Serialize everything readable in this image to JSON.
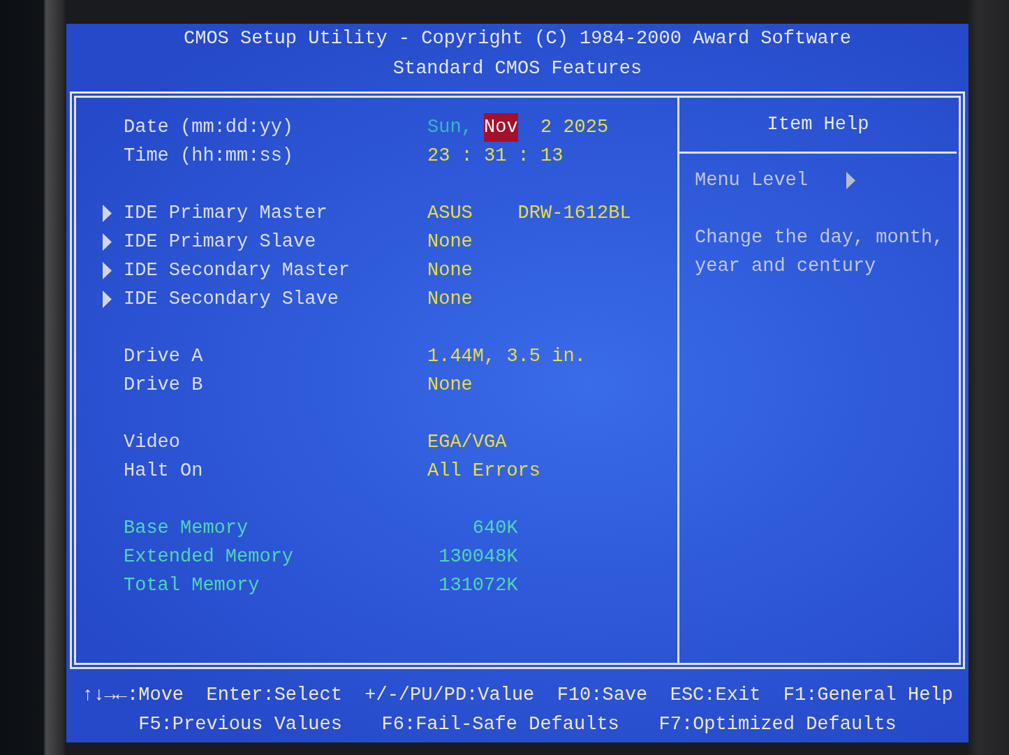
{
  "header": {
    "title": "CMOS Setup Utility - Copyright (C) 1984-2000 Award Software",
    "subtitle": "Standard CMOS Features"
  },
  "setting_groups": [
    {
      "rows": [
        {
          "kind": "date",
          "label": "Date (mm:dd:yy)",
          "weekday": "Sun,",
          "fields": [
            {
              "text": "Nov",
              "selected": true
            },
            {
              "text": "2",
              "selected": false
            },
            {
              "text": "2025",
              "selected": false
            }
          ]
        },
        {
          "kind": "time",
          "label": "Time (hh:mm:ss)",
          "separator": ":",
          "fields": [
            {
              "text": "23",
              "selected": false
            },
            {
              "text": "31",
              "selected": false
            },
            {
              "text": "13",
              "selected": false
            }
          ]
        }
      ]
    },
    {
      "rows": [
        {
          "kind": "submenu",
          "label": "IDE Primary Master",
          "value": "ASUS    DRW-1612BL"
        },
        {
          "kind": "submenu",
          "label": "IDE Primary Slave",
          "value": "None"
        },
        {
          "kind": "submenu",
          "label": "IDE Secondary Master",
          "value": "None"
        },
        {
          "kind": "submenu",
          "label": "IDE Secondary Slave",
          "value": "None"
        }
      ]
    },
    {
      "rows": [
        {
          "kind": "option",
          "label": "Drive A",
          "value": "1.44M, 3.5 in."
        },
        {
          "kind": "option",
          "label": "Drive B",
          "value": "None"
        }
      ]
    },
    {
      "rows": [
        {
          "kind": "option",
          "label": "Video",
          "value": "EGA/VGA"
        },
        {
          "kind": "option",
          "label": "Halt On",
          "value": "All Errors"
        }
      ]
    },
    {
      "rows": [
        {
          "kind": "info",
          "label": "Base Memory",
          "value": "640K"
        },
        {
          "kind": "info",
          "label": "Extended Memory",
          "value": "130048K"
        },
        {
          "kind": "info",
          "label": "Total Memory",
          "value": "131072K"
        }
      ]
    }
  ],
  "item_help": {
    "title": "Item Help",
    "menu_level": "Menu Level",
    "text": "Change the day, month, year and century"
  },
  "key_hints": [
    {
      "hints": [
        "↑↓→←:Move",
        "Enter:Select",
        "+/-/PU/PD:Value",
        "F10:Save",
        "ESC:Exit",
        "F1:General Help"
      ]
    },
    {
      "hints": [
        "F5:Previous Values",
        "F6:Fail-Safe Defaults",
        "F7:Optimized Defaults"
      ]
    }
  ]
}
